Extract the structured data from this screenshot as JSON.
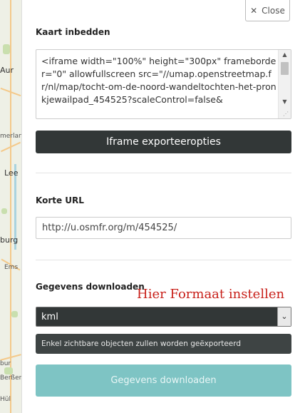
{
  "map": {
    "place_labels": [
      "Aur",
      "merlan",
      "Lee",
      "burg",
      "Ems",
      "bur",
      "Berßen",
      "Hül"
    ]
  },
  "close": {
    "label": "Close",
    "icon": "close-icon"
  },
  "embed": {
    "title": "Kaart inbedden",
    "code": "<iframe width=\"100%\" height=\"300px\" frameborder=\"0\" allowfullscreen src=\"//umap.openstreetmap.fr/nl/map/tocht-om-de-noord-wandeltochten-het-pronkjewailpad_454525?scaleControl=false&",
    "options_button": "Iframe exporteeropties"
  },
  "short_url": {
    "title": "Korte URL",
    "value": "http://u.osmfr.org/m/454525/"
  },
  "download": {
    "title": "Gegevens downloaden",
    "annotation": "Hier Formaat instellen",
    "format_value": "kml",
    "info": "Enkel zichtbare objecten zullen worden geëxporteerd",
    "button": "Gegevens downloaden"
  },
  "colors": {
    "dark_button": "#323737",
    "download_button": "#7ec4c4",
    "annotation": "#c8201a"
  }
}
